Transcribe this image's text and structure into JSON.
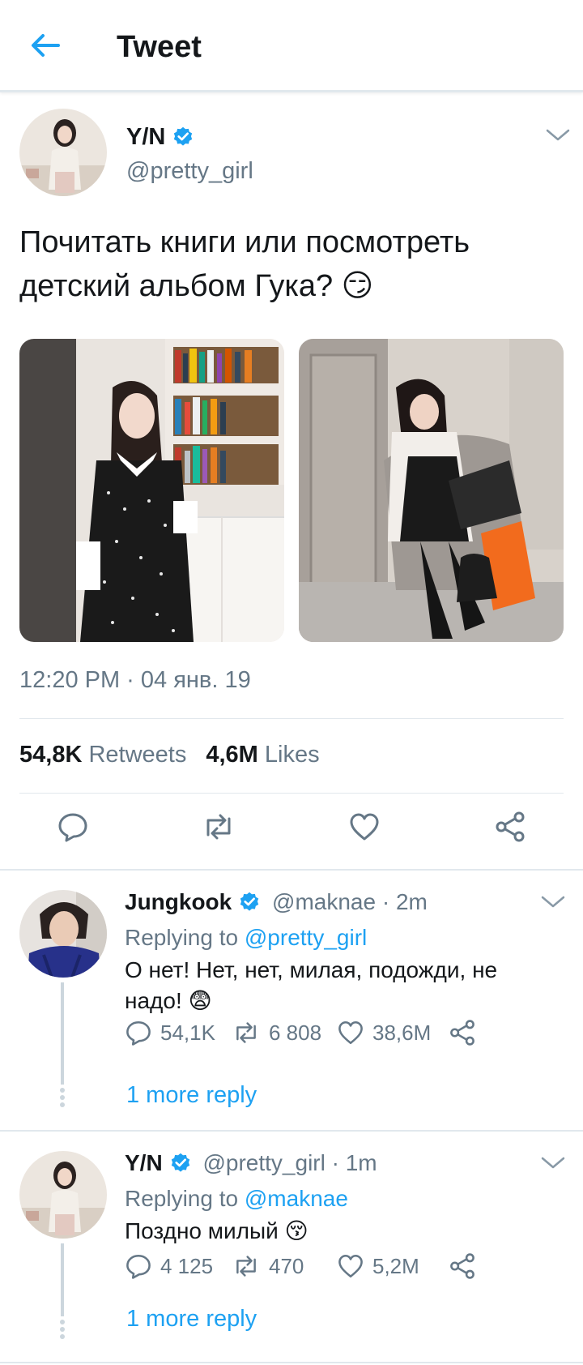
{
  "header": {
    "title": "Tweet",
    "back_icon": "arrow-left-icon"
  },
  "colors": {
    "accent": "#1da1f2",
    "muted": "#657786",
    "divider": "#e1e8ed",
    "text": "#14171a"
  },
  "tweet": {
    "author_name": "Y/N",
    "author_handle": "@pretty_girl",
    "text": "Почитать книги или посмотреть детский альбом Гука? 😏",
    "timestamp": "12:20 PM · 04 янв. 19",
    "retweets_count": "54,8K",
    "retweets_label": "Retweets",
    "likes_count": "4,6M",
    "likes_label": "Likes",
    "actions": [
      "reply-icon",
      "retweet-icon",
      "like-icon",
      "share-icon"
    ]
  },
  "replies": [
    {
      "author_name": "Jungkook",
      "author_handle": "@maknae",
      "time": "· 2m",
      "replying_prefix": "Replying to",
      "replying_to": "@pretty_girl",
      "text": "О нет! Нет, нет, милая, подожди, не надо! 😨",
      "reply_count": "54,1K",
      "retweet_count": "6 808",
      "like_count": "38,6M",
      "more_reply": "1 more reply"
    },
    {
      "author_name": "Y/N",
      "author_handle": "@pretty_girl",
      "time": "· 1m",
      "replying_prefix": "Replying to",
      "replying_to": "@maknae",
      "text": "Поздно милый 😚",
      "reply_count": "4 125",
      "retweet_count": "470",
      "like_count": "5,2M",
      "more_reply": "1 more reply"
    }
  ]
}
